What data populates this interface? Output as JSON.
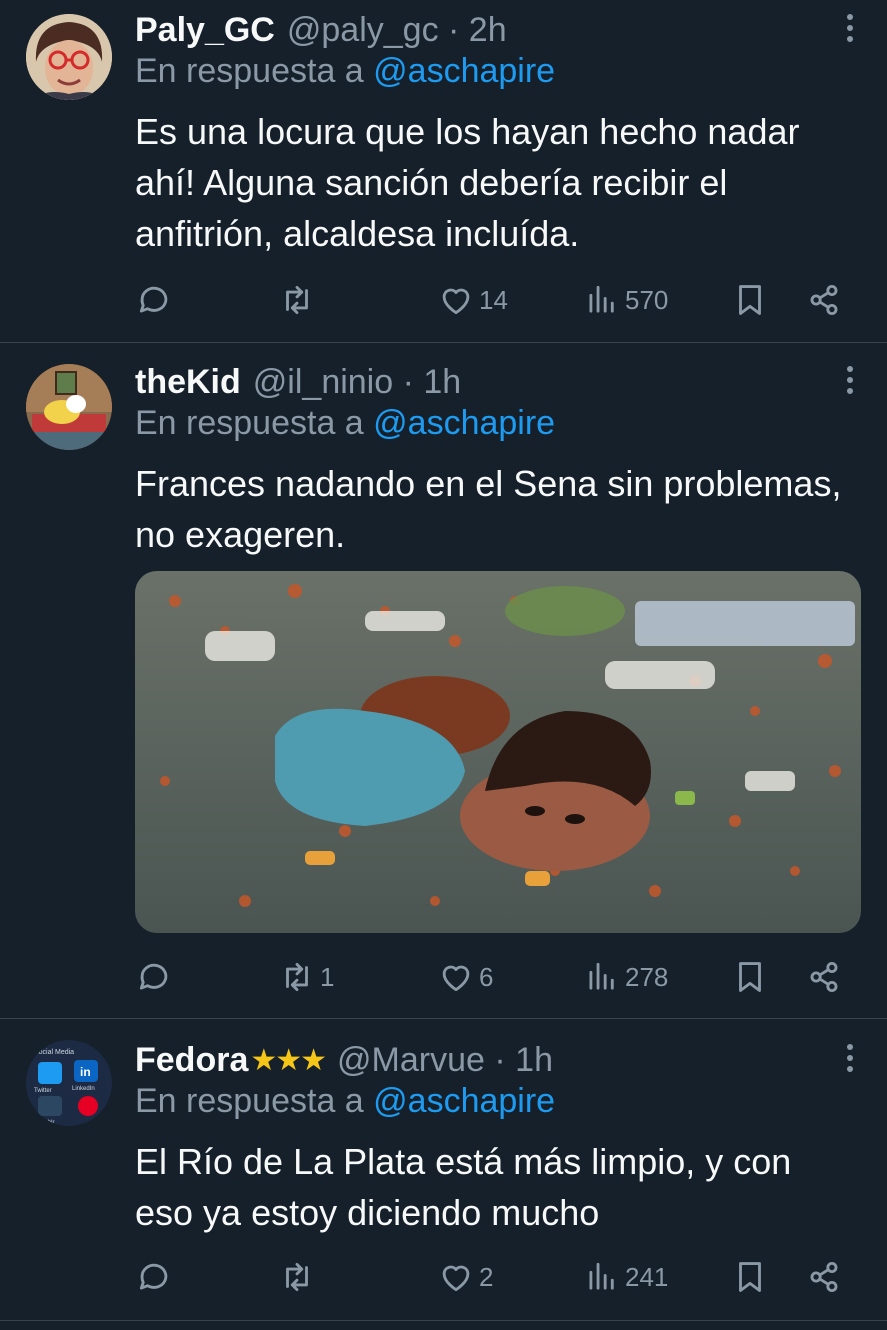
{
  "tweets": [
    {
      "name": "Paly_GC",
      "stars": "",
      "handle": "@paly_gc",
      "time": "· 2h",
      "reply_prefix": "En respuesta a",
      "reply_to": "@aschapire",
      "text": "Es una locura que los hayan hecho nadar ahí! Alguna sanción debería recibir el anfitrión, alcaldesa incluída.",
      "replies": "",
      "retweets": "",
      "likes": "14",
      "views": "570"
    },
    {
      "name": "theKid",
      "stars": "",
      "handle": "@il_ninio",
      "time": "· 1h",
      "reply_prefix": "En respuesta a",
      "reply_to": "@aschapire",
      "text": "Frances nadando en el Sena sin problemas, no exageren.",
      "replies": "",
      "retweets": "1",
      "likes": "6",
      "views": "278"
    },
    {
      "name": "Fedora",
      "stars": "★★★",
      "handle": "@Marvue",
      "time": "· 1h",
      "reply_prefix": "En respuesta a",
      "reply_to": "@aschapire",
      "text": "El Río de La Plata está más limpio, y con eso ya estoy diciendo mucho",
      "replies": "",
      "retweets": "",
      "likes": "2",
      "views": "241"
    }
  ],
  "avatar3_labels": {
    "top": "Social Media",
    "twitter": "Twitter",
    "linkedin": "LinkedIn",
    "tumblr": "Tumblr",
    "in_badge": "in"
  },
  "colors": {
    "background": "#15202b",
    "text": "#f7f9f9",
    "muted": "#8b98a5",
    "link": "#1d9bf0",
    "divider": "#38444d",
    "star": "#f5c518"
  },
  "icons": [
    "reply-icon",
    "retweet-icon",
    "like-icon",
    "views-icon",
    "bookmark-icon",
    "share-icon",
    "more-icon"
  ]
}
